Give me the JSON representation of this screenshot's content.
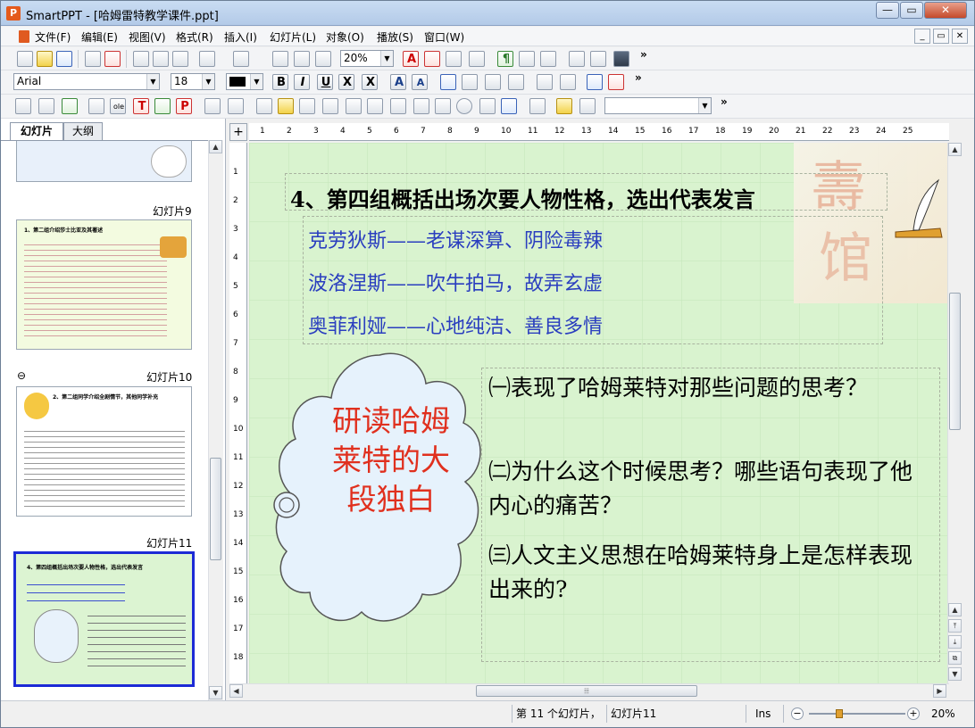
{
  "window": {
    "app_name": "SmartPPT",
    "title": "SmartPPT - [哈姆雷特教学课件.ppt]",
    "icon_letter": "P",
    "controls": {
      "minimize": "—",
      "maximize": "▭",
      "close": "✕"
    }
  },
  "menubar": {
    "items": [
      "文件(F)",
      "编辑(E)",
      "视图(V)",
      "格式(R)",
      "插入(I)",
      "幻灯片(L)",
      "对象(O)",
      "播放(S)",
      "窗口(W)"
    ],
    "mdi": {
      "minimize": "_",
      "restore": "▭",
      "close": "✕"
    }
  },
  "toolbar": {
    "zoom_value": "20%",
    "font_name": "Arial",
    "font_size": "18",
    "overflow": "»",
    "text_icons": {
      "text_a": "A",
      "paragraph": "¶",
      "bold": "B",
      "italic": "I",
      "underline": "U",
      "strike": "X",
      "strike2": "X",
      "grow": "A",
      "shrink": "A",
      "ole": "ole",
      "t_box": "T",
      "p_box": "P"
    }
  },
  "sidepanel": {
    "tabs": [
      "幻灯片",
      "大纲"
    ],
    "thumbnails": [
      {
        "label": "幻灯片9",
        "title": "1、第二组介绍莎士比亚及其著述"
      },
      {
        "label": "幻灯片10",
        "title": "2、第二组同学介绍全剧情节，其他同学补充"
      },
      {
        "label": "幻灯片11",
        "title": "4、第四组概括出场次要人物性格，选出代表发言"
      }
    ]
  },
  "slide": {
    "title": "4、第四组概括出场次要人物性格，选出代表发言",
    "characters": [
      "克劳狄斯——老谋深算、阴险毒辣",
      "波洛涅斯——吹牛拍马，故弄玄虚",
      "奥菲利娅——心地纯洁、善良多情"
    ],
    "cloud_text": "研读哈姆莱特的大段独白",
    "questions": [
      "㈠表现了哈姆莱特对那些问题的思考？",
      "㈡为什么这个时候思考？哪些语句表现了他内心的痛苦？",
      "㈢人文主义思想在哈姆莱特身上是怎样表现出来的?"
    ],
    "background_color": "#d9f3cf"
  },
  "ruler": {
    "h_ticks": [
      "1",
      "2",
      "3",
      "4",
      "5",
      "6",
      "7",
      "8",
      "9",
      "10",
      "11",
      "12",
      "13",
      "14",
      "15",
      "16",
      "17",
      "18",
      "19",
      "20",
      "21",
      "22",
      "23",
      "24",
      "25"
    ],
    "v_ticks": [
      "1",
      "2",
      "3",
      "4",
      "5",
      "6",
      "7",
      "8",
      "9",
      "10",
      "11",
      "12",
      "13",
      "14",
      "15",
      "16",
      "17",
      "18"
    ]
  },
  "statusbar": {
    "slide_position": "第 11 个幻灯片，",
    "slide_name": "幻灯片11",
    "mode": "Ins",
    "zoom": "20%",
    "zoom_minus": "−",
    "zoom_plus": "+"
  },
  "scroll": {
    "up": "▲",
    "down": "▼",
    "left": "◀",
    "right": "▶",
    "grip": "⦙⦙⦙",
    "prev_page": "⤒",
    "next_page": "⤓",
    "restore": "⧉"
  }
}
